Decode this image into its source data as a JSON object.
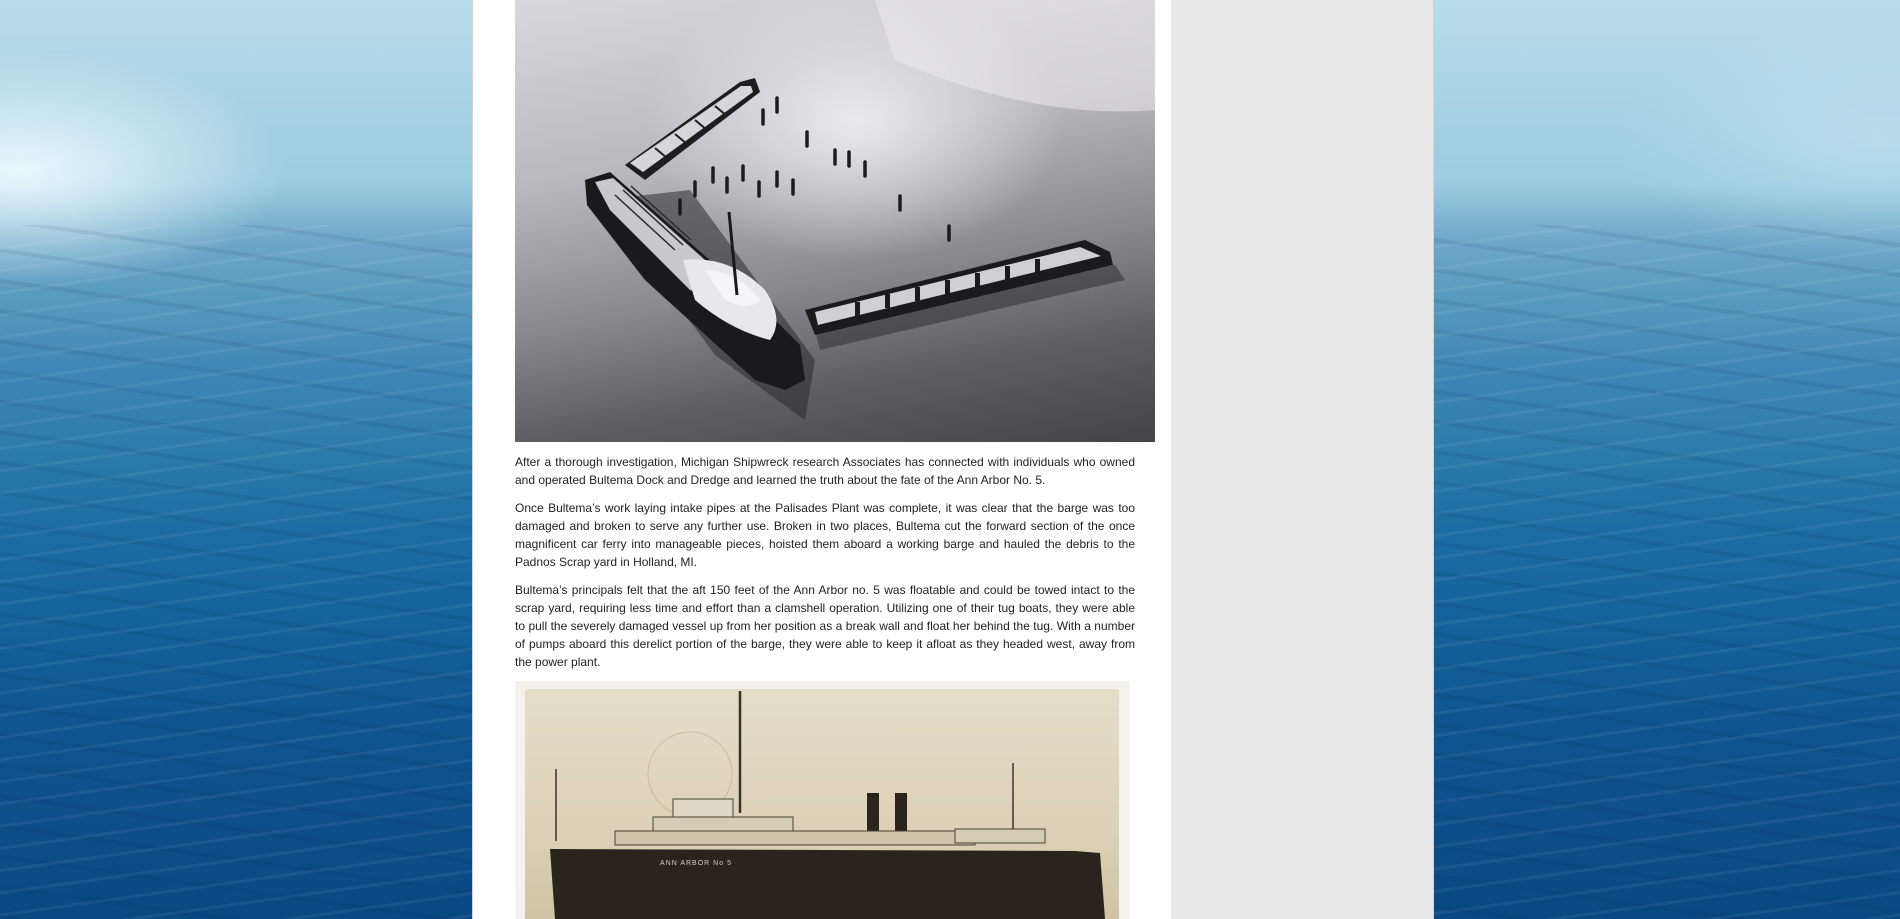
{
  "article": {
    "paragraphs": [
      "After a thorough investigation, Michigan Shipwreck research Associates has connected with individuals who owned and operated Bultema Dock and Dredge and learned the truth about the fate of the Ann Arbor No. 5.",
      "Once Bultema’s work laying intake pipes at the Palisades Plant was complete, it was clear that the barge was too damaged and broken to serve any further use. Broken in two places, Bultema cut the forward section of the once magnificent car ferry into manageable pieces, hoisted them aboard a working barge and hauled the debris to the Padnos Scrap yard in Holland, MI.",
      "Bultema’s principals felt that the aft 150 feet of the Ann Arbor no. 5 was floatable and could be towed intact to the scrap yard, requiring less time and effort than a clamshell operation. Utilizing one of their tug boats, they were able to pull the severely damaged vessel up from her position as a break wall and float her behind the tug. With a number of pumps aboard this derelict portion of the barge, they were able to keep it afloat as they headed west, away from the power plant."
    ],
    "photo2_hull_lettering": "ANN ARBOR No 5"
  },
  "colors": {
    "page_panel": "#e8e8e8",
    "content_bg": "#ffffff",
    "text": "#222222"
  }
}
